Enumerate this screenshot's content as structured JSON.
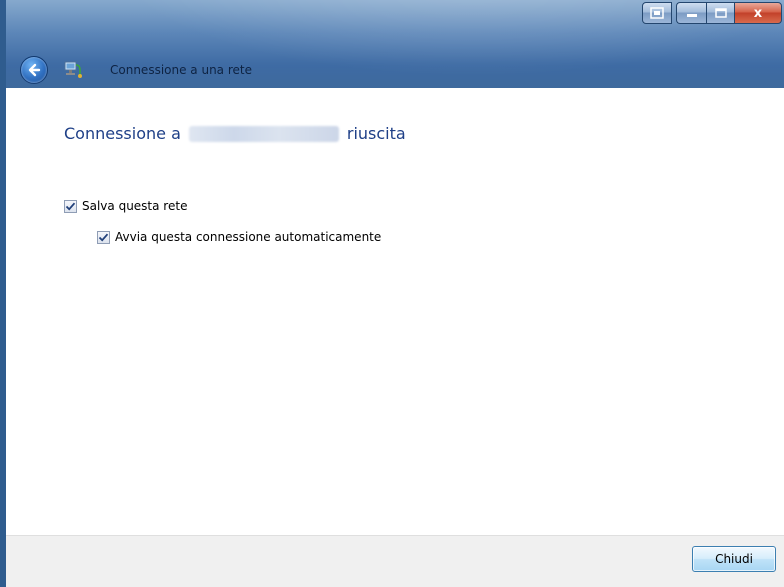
{
  "window": {
    "title": "Connessione a una rete",
    "caption_buttons": {
      "extra_icon": "window-switch-icon",
      "minimize_icon": "minimize-icon",
      "maximize_icon": "maximize-icon",
      "close_label": "x"
    }
  },
  "nav": {
    "back_icon": "back-arrow-icon",
    "app_icon": "network-connection-icon"
  },
  "content": {
    "heading_prefix": "Connessione a",
    "heading_suffix": "riuscita",
    "checkboxes": [
      {
        "label": "Salva questa rete",
        "checked": true
      },
      {
        "label": "Avvia questa connessione automaticamente",
        "checked": true
      }
    ]
  },
  "footer": {
    "close_button_label": "Chiudi"
  },
  "colors": {
    "title_bar": "#3d6aa3",
    "heading": "#1e3f87",
    "close_button": "#c2412a",
    "footer_bg": "#f0f0f0"
  }
}
